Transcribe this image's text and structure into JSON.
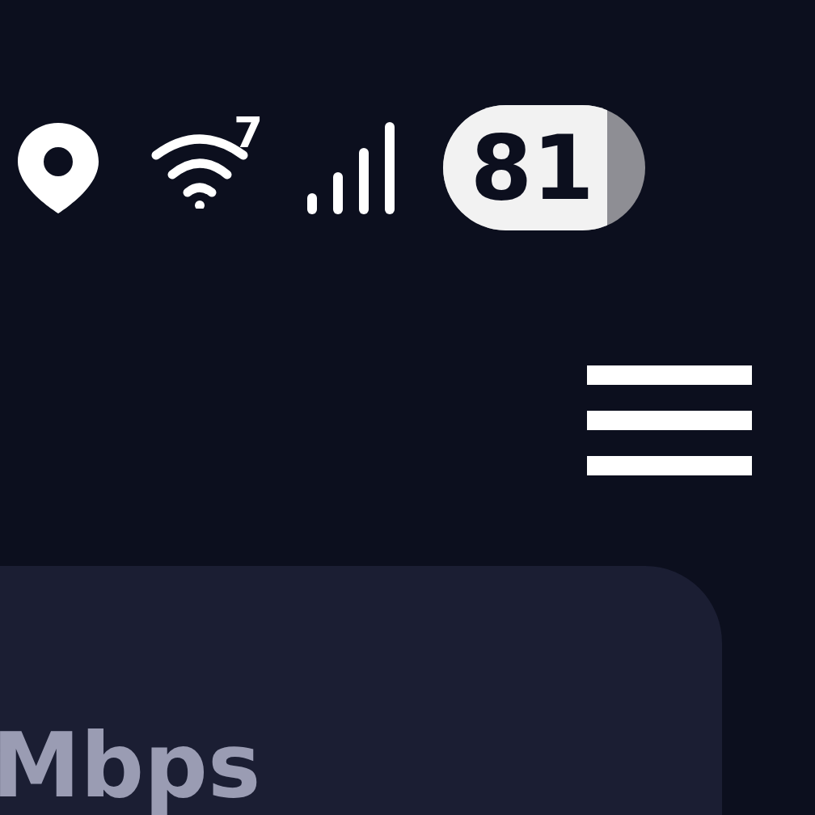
{
  "status_bar": {
    "wifi_badge": "7",
    "battery": {
      "text": "81",
      "level": 0.81
    }
  },
  "card": {
    "unit": "Mbps"
  }
}
